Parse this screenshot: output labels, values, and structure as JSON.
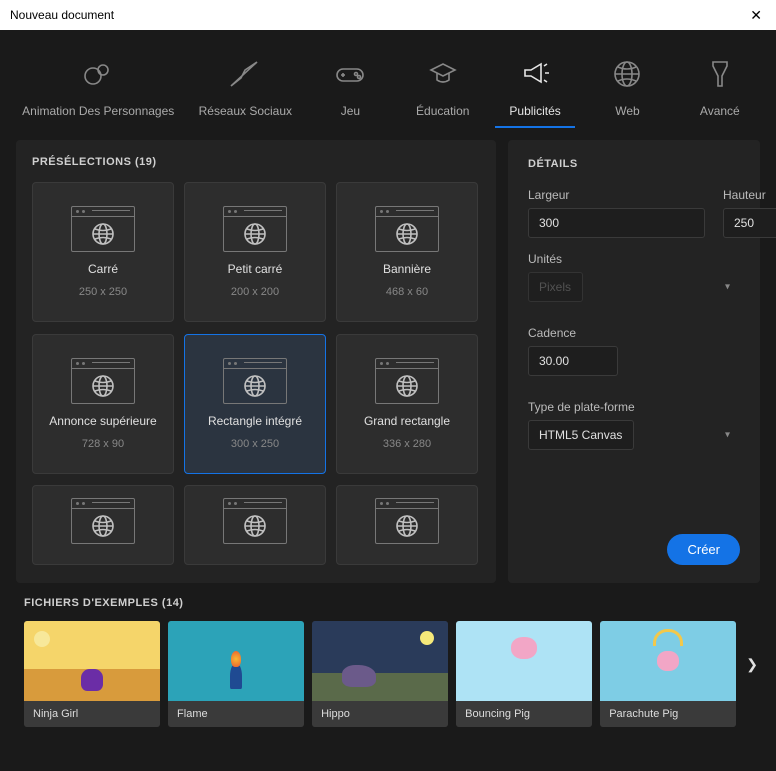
{
  "window_title": "Nouveau document",
  "categories": [
    {
      "id": "char",
      "label": "Animation Des Personnages"
    },
    {
      "id": "social",
      "label": "Réseaux Sociaux"
    },
    {
      "id": "game",
      "label": "Jeu"
    },
    {
      "id": "edu",
      "label": "Éducation"
    },
    {
      "id": "ads",
      "label": "Publicités",
      "active": true
    },
    {
      "id": "web",
      "label": "Web"
    },
    {
      "id": "adv",
      "label": "Avancé"
    }
  ],
  "presets_title": "PRÉSÉLECTIONS (19)",
  "presets_count": 19,
  "presets": [
    {
      "name": "Carré",
      "dim": "250 x 250"
    },
    {
      "name": "Petit carré",
      "dim": "200 x 200"
    },
    {
      "name": "Bannière",
      "dim": "468 x 60"
    },
    {
      "name": "Annonce supérieure",
      "dim": "728 x 90"
    },
    {
      "name": "Rectangle intégré",
      "dim": "300 x 250",
      "selected": true
    },
    {
      "name": "Grand rectangle",
      "dim": "336 x 280"
    }
  ],
  "details": {
    "title": "DÉTAILS",
    "width_label": "Largeur",
    "width_value": "300",
    "height_label": "Hauteur",
    "height_value": "250",
    "units_label": "Unités",
    "units_value": "Pixels",
    "fps_label": "Cadence",
    "fps_value": "30.00",
    "platform_label": "Type de plate-forme",
    "platform_value": "HTML5 Canvas",
    "create_label": "Créer"
  },
  "examples_title": "FICHIERS D'EXEMPLES (14)",
  "examples_count": 14,
  "examples": [
    {
      "title": "Ninja Girl",
      "cls": "ninja"
    },
    {
      "title": "Flame",
      "cls": "flame"
    },
    {
      "title": "Hippo",
      "cls": "hippo"
    },
    {
      "title": "Bouncing Pig",
      "cls": "bpig"
    },
    {
      "title": "Parachute Pig",
      "cls": "ppig"
    }
  ]
}
